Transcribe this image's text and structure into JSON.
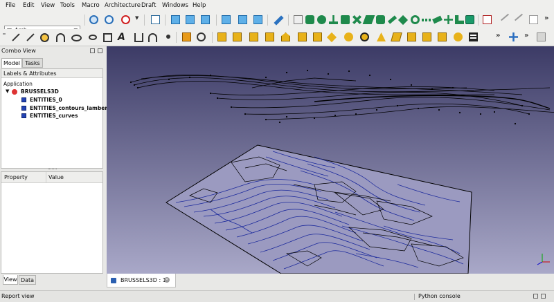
{
  "menubar": {
    "items": [
      {
        "label": "File"
      },
      {
        "label": "Edit"
      },
      {
        "label": "View"
      },
      {
        "label": "Tools"
      },
      {
        "label": "Macro"
      },
      {
        "label": "Architecture"
      },
      {
        "label": "Draft"
      },
      {
        "label": "Windows"
      },
      {
        "label": "Help"
      }
    ]
  },
  "toolbar": {
    "workbench": "Arch",
    "overflow_glyph": "»"
  },
  "combo_view": {
    "title": "Combo View",
    "tabs": [
      {
        "label": "Model"
      },
      {
        "label": "Tasks"
      }
    ],
    "tree_header": "Labels & Attributes",
    "tree": {
      "root": "Application",
      "document": "BRUSSELS3D",
      "objects": [
        "ENTITIES_0",
        "ENTITIES_contours_lambert",
        "ENTITIES_curves"
      ]
    },
    "property_header": {
      "property": "Property",
      "value": "Value"
    },
    "bottom_tabs": [
      {
        "label": "View"
      },
      {
        "label": "Data"
      }
    ]
  },
  "document_tab": {
    "label": "BRUSSELS3D : 1*"
  },
  "statusbar": {
    "left": "Report view",
    "right": "Python console"
  },
  "colors": {
    "viewport_top": "#3c3b66",
    "viewport_bottom": "#a9a8c8",
    "contour_lines": "#1c2a9c",
    "linework": "#000000"
  }
}
